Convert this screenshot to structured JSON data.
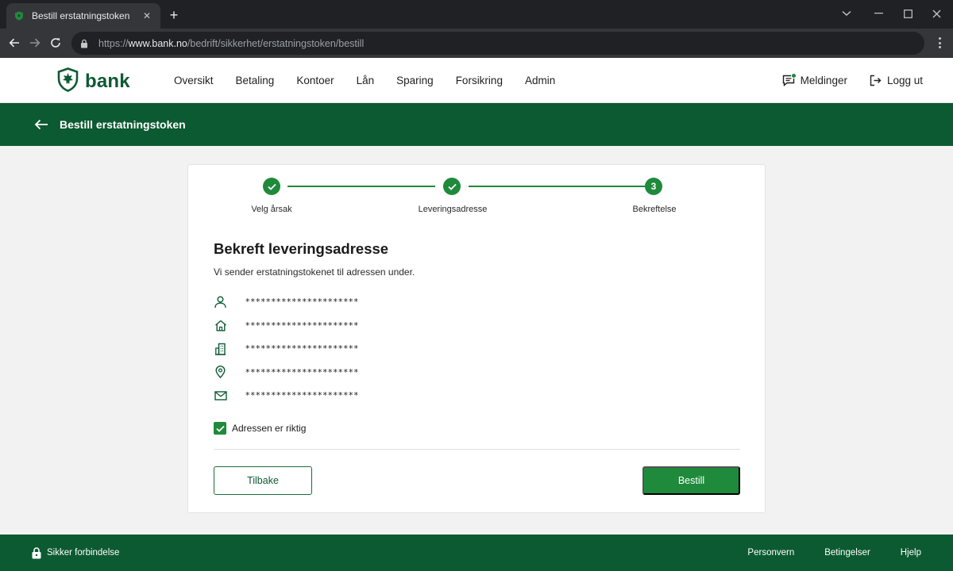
{
  "browser": {
    "tab_title": "Bestill erstatningstoken",
    "tab_close": "✕",
    "new_tab": "+",
    "url_scheme": "https://",
    "url_host": "www.bank.no",
    "url_path": "/bedrift/sikkerhet/erstatningstoken/bestill"
  },
  "header": {
    "brand": "bank",
    "nav": [
      "Oversikt",
      "Betaling",
      "Kontoer",
      "Lån",
      "Sparing",
      "Forsikring",
      "Admin"
    ],
    "messages": "Meldinger",
    "logout": "Logg ut"
  },
  "page": {
    "title": "Bestill erstatningstoken"
  },
  "stepper": {
    "steps": [
      {
        "label": "Velg årsak",
        "state": "done"
      },
      {
        "label": "Leveringsadresse",
        "state": "done"
      },
      {
        "label": "Bekreftelse",
        "number": "3",
        "state": "active"
      }
    ]
  },
  "card": {
    "title": "Bekreft leveringsadresse",
    "description": "Vi sender erstatningstokenet til adressen under.",
    "address": [
      {
        "icon": "person-icon",
        "value": "**********************"
      },
      {
        "icon": "home-icon",
        "value": "**********************"
      },
      {
        "icon": "building-icon",
        "value": "**********************"
      },
      {
        "icon": "location-pin-icon",
        "value": "**********************"
      },
      {
        "icon": "mail-icon",
        "value": "**********************"
      }
    ],
    "confirm_label": "Adressen er riktig",
    "confirm_checked": true,
    "back_button": "Tilbake",
    "submit_button": "Bestill"
  },
  "footer": {
    "secure": "Sikker forbindelse",
    "links": [
      "Personvern",
      "Betingelser",
      "Hjelp"
    ]
  },
  "colors": {
    "brand_dark": "#0c5a31",
    "accent": "#1f8a3b",
    "chrome_dark": "#202124",
    "chrome_mid": "#35363a"
  }
}
